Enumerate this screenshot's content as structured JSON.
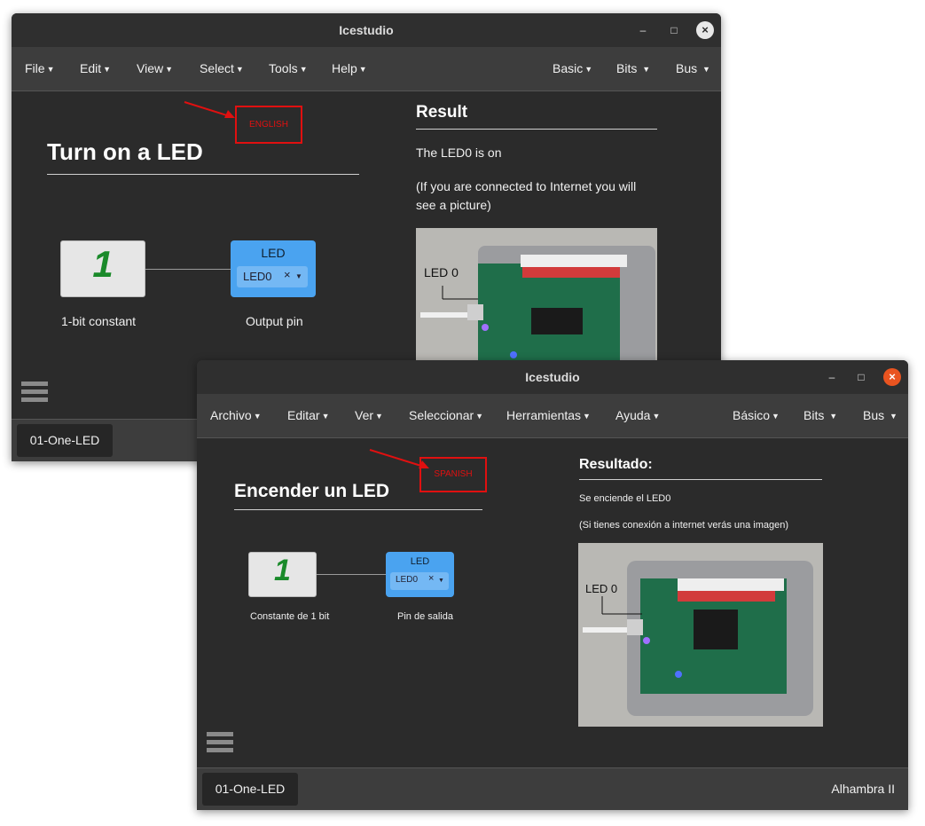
{
  "colors": {
    "accent_red": "#e01010",
    "block_blue": "#4aa3f0",
    "close_orange": "#e95420"
  },
  "english": {
    "window_title": "Icestudio",
    "menus": [
      "File",
      "Edit",
      "View",
      "Select",
      "Tools",
      "Help"
    ],
    "right_menus": [
      "Basic",
      "Bits",
      "Bus"
    ],
    "language_label": "ENGLISH",
    "heading": "Turn on a LED",
    "constant_value": "1",
    "constant_label": "1-bit constant",
    "led_block_title": "LED",
    "led_select_value": "LED0",
    "output_label": "Output pin",
    "result_heading": "Result",
    "result_text": "The LED0 is on",
    "result_note": "(If you are connected to Internet you will see a picture)",
    "photo_label": "LED 0",
    "tab": "01-One-LED"
  },
  "spanish": {
    "window_title": "Icestudio",
    "menus": [
      "Archivo",
      "Editar",
      "Ver",
      "Seleccionar",
      "Herramientas",
      "Ayuda"
    ],
    "right_menus": [
      "Básico",
      "Bits",
      "Bus"
    ],
    "language_label": "SPANISH",
    "heading": "Encender un LED",
    "constant_value": "1",
    "constant_label": "Constante de 1 bit",
    "led_block_title": "LED",
    "led_select_value": "LED0",
    "output_label": "Pin de salida",
    "result_heading": "Resultado:",
    "result_text": "Se enciende el LED0",
    "result_note": "(Si tienes conexión a internet verás una imagen)",
    "photo_label": "LED 0",
    "tab": "01-One-LED",
    "board": "Alhambra II"
  },
  "icons": {
    "minimize": "minimize-icon",
    "maximize": "maximize-icon",
    "close": "close-icon",
    "menu": "hamburger-menu-icon",
    "remove": "clear-x-icon",
    "dropdown": "caret-down-icon"
  }
}
